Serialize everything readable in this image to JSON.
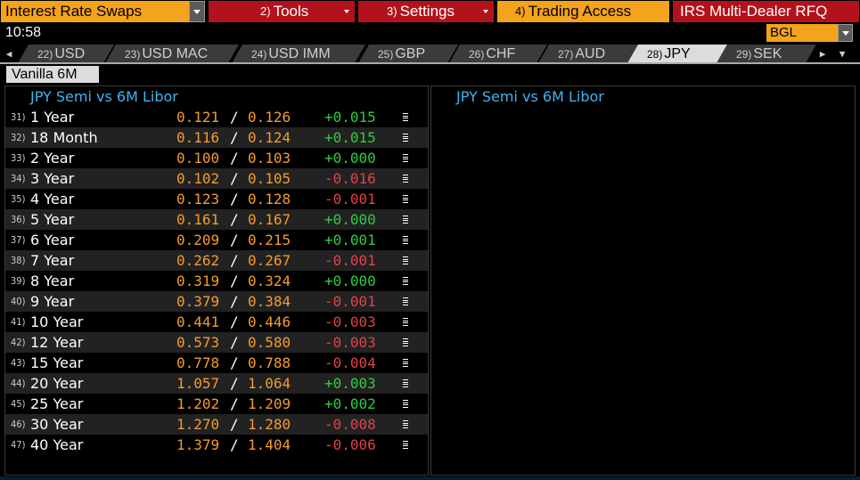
{
  "menu": {
    "title": "Interest Rate Swaps",
    "tools": {
      "num": "2)",
      "label": "Tools"
    },
    "settings": {
      "num": "3)",
      "label": "Settings"
    },
    "trading": {
      "num": "4)",
      "label": "Trading Access"
    },
    "rfq": "IRS Multi-Dealer RFQ"
  },
  "time": "10:58",
  "source_field": "BGL",
  "tabs": [
    {
      "num": "22)",
      "label": "USD"
    },
    {
      "num": "23)",
      "label": "USD MAC"
    },
    {
      "num": "24)",
      "label": "USD IMM"
    },
    {
      "num": "25)",
      "label": "GBP"
    },
    {
      "num": "26)",
      "label": "CHF"
    },
    {
      "num": "27)",
      "label": "AUD"
    },
    {
      "num": "28)",
      "label": "JPY"
    },
    {
      "num": "29)",
      "label": "SEK"
    }
  ],
  "active_tab": "JPY",
  "subtab": "Vanilla 6M",
  "left_pane": {
    "title": "JPY Semi vs 6M Libor",
    "rows": [
      {
        "idx": "31)",
        "tenor": "1 Year",
        "bid": "0.121",
        "ask": "0.126",
        "change": "+0.015",
        "dir": "up"
      },
      {
        "idx": "32)",
        "tenor": "18 Month",
        "bid": "0.116",
        "ask": "0.124",
        "change": "+0.015",
        "dir": "up"
      },
      {
        "idx": "33)",
        "tenor": "2 Year",
        "bid": "0.100",
        "ask": "0.103",
        "change": "+0.000",
        "dir": "flat"
      },
      {
        "idx": "34)",
        "tenor": "3 Year",
        "bid": "0.102",
        "ask": "0.105",
        "change": "-0.016",
        "dir": "down"
      },
      {
        "idx": "35)",
        "tenor": "4 Year",
        "bid": "0.123",
        "ask": "0.128",
        "change": "-0.001",
        "dir": "down"
      },
      {
        "idx": "36)",
        "tenor": "5 Year",
        "bid": "0.161",
        "ask": "0.167",
        "change": "+0.000",
        "dir": "flat"
      },
      {
        "idx": "37)",
        "tenor": "6 Year",
        "bid": "0.209",
        "ask": "0.215",
        "change": "+0.001",
        "dir": "up"
      },
      {
        "idx": "38)",
        "tenor": "7 Year",
        "bid": "0.262",
        "ask": "0.267",
        "change": "-0.001",
        "dir": "down"
      },
      {
        "idx": "39)",
        "tenor": "8 Year",
        "bid": "0.319",
        "ask": "0.324",
        "change": "+0.000",
        "dir": "flat"
      },
      {
        "idx": "40)",
        "tenor": "9 Year",
        "bid": "0.379",
        "ask": "0.384",
        "change": "-0.001",
        "dir": "down"
      },
      {
        "idx": "41)",
        "tenor": "10 Year",
        "bid": "0.441",
        "ask": "0.446",
        "change": "-0.003",
        "dir": "down"
      },
      {
        "idx": "42)",
        "tenor": "12 Year",
        "bid": "0.573",
        "ask": "0.580",
        "change": "-0.003",
        "dir": "down"
      },
      {
        "idx": "43)",
        "tenor": "15 Year",
        "bid": "0.778",
        "ask": "0.788",
        "change": "-0.004",
        "dir": "down"
      },
      {
        "idx": "44)",
        "tenor": "20 Year",
        "bid": "1.057",
        "ask": "1.064",
        "change": "+0.003",
        "dir": "up"
      },
      {
        "idx": "45)",
        "tenor": "25 Year",
        "bid": "1.202",
        "ask": "1.209",
        "change": "+0.002",
        "dir": "up"
      },
      {
        "idx": "46)",
        "tenor": "30 Year",
        "bid": "1.270",
        "ask": "1.280",
        "change": "-0.008",
        "dir": "down"
      },
      {
        "idx": "47)",
        "tenor": "40 Year",
        "bid": "1.379",
        "ask": "1.404",
        "change": "-0.006",
        "dir": "down"
      }
    ]
  },
  "right_pane": {
    "title": "JPY Semi vs 6M Libor"
  },
  "colors": {
    "orange": "#f5a21c",
    "red_menu": "#b3121c",
    "price": "#f39c2c",
    "up": "#2ecc40",
    "down": "#e0424a",
    "title_blue": "#3fb4f0"
  }
}
